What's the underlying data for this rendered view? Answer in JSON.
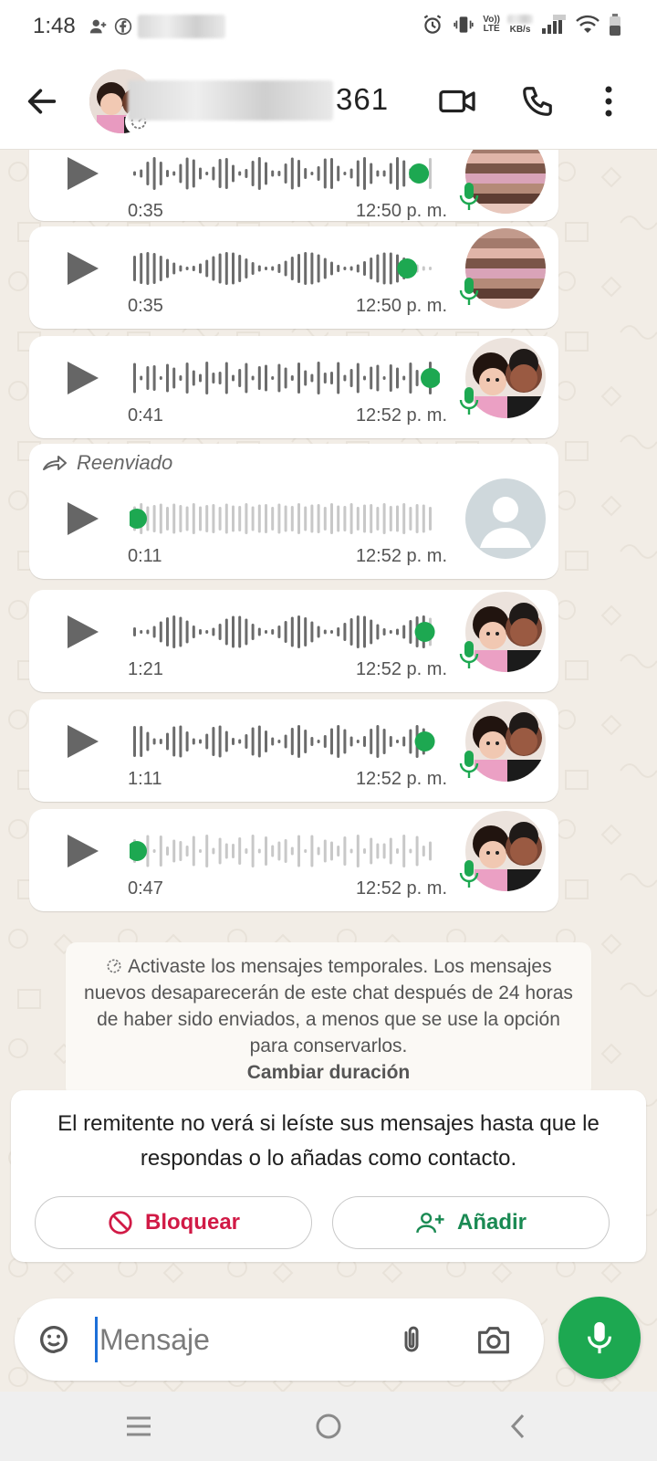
{
  "status_bar": {
    "time": "1:48",
    "lte_label_top": "Vo))",
    "lte_label_bottom": "LTE",
    "speed_label": "KB/s"
  },
  "header": {
    "contact_name_suffix": "361",
    "icons": [
      "back-arrow-icon",
      "video-call-icon",
      "phone-icon",
      "more-vert-icon"
    ]
  },
  "messages": [
    {
      "duration": "0:35",
      "time": "12:50 p. m.",
      "played": true,
      "progress": 0.96,
      "forwarded": false
    },
    {
      "duration": "0:35",
      "time": "12:50 p. m.",
      "played": true,
      "progress": 0.92,
      "forwarded": false
    },
    {
      "duration": "0:41",
      "time": "12:52 p. m.",
      "played": true,
      "progress": 1.0,
      "forwarded": false
    },
    {
      "duration": "0:11",
      "time": "12:52 p. m.",
      "played": false,
      "progress": 0.0,
      "forwarded": true,
      "forwarded_label": "Reenviado"
    },
    {
      "duration": "1:21",
      "time": "12:52 p. m.",
      "played": true,
      "progress": 0.98,
      "forwarded": false
    },
    {
      "duration": "1:11",
      "time": "12:52 p. m.",
      "played": true,
      "progress": 0.98,
      "forwarded": false
    },
    {
      "duration": "0:47",
      "time": "12:52 p. m.",
      "played": false,
      "progress": 0.0,
      "forwarded": false
    }
  ],
  "system_note": {
    "text": "Activaste los mensajes temporales. Los mensajes nuevos desaparecerán de este chat después de 24 horas de haber sido enviados, a menos que se use la opción para conservarlos.",
    "link": "Cambiar duración"
  },
  "info_card": {
    "text": "El remitente no verá si leíste sus mensajes hasta que le respondas o lo añadas como contacto.",
    "block_label": "Bloquear",
    "add_label": "Añadir"
  },
  "composer": {
    "placeholder": "Mensaje"
  },
  "colors": {
    "accent_green": "#1da851",
    "block_red": "#d11a46",
    "add_green": "#1a8a53",
    "chat_bg": "#f2ede6"
  }
}
